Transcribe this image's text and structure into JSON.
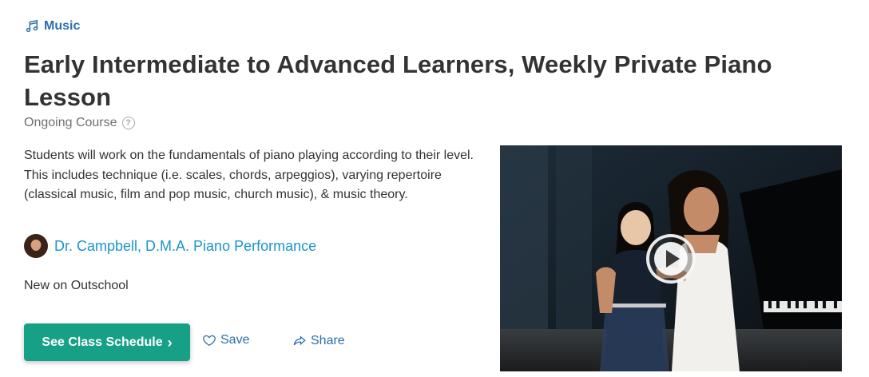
{
  "category": {
    "label": "Music",
    "icon": "music-note-icon",
    "color": "#2c6fb0"
  },
  "title": "Early Intermediate to Advanced Learners, Weekly Private Piano Lesson",
  "course_type": "Ongoing Course",
  "description": "Students will work on the fundamentals of piano playing according to their level. This includes technique (i.e. scales, chords, arpeggios), varying repertoire (classical music, film and pop music, church music), & music theory.",
  "teacher": {
    "name": "Dr. Campbell, D.M.A. Piano Performance",
    "color": "#1b95c9"
  },
  "badge": "New on Outschool",
  "actions": {
    "schedule_label": "See Class Schedule",
    "schedule_color": "#16a085",
    "save_label": "Save",
    "share_label": "Share"
  },
  "video": {
    "icon": "play-icon"
  }
}
